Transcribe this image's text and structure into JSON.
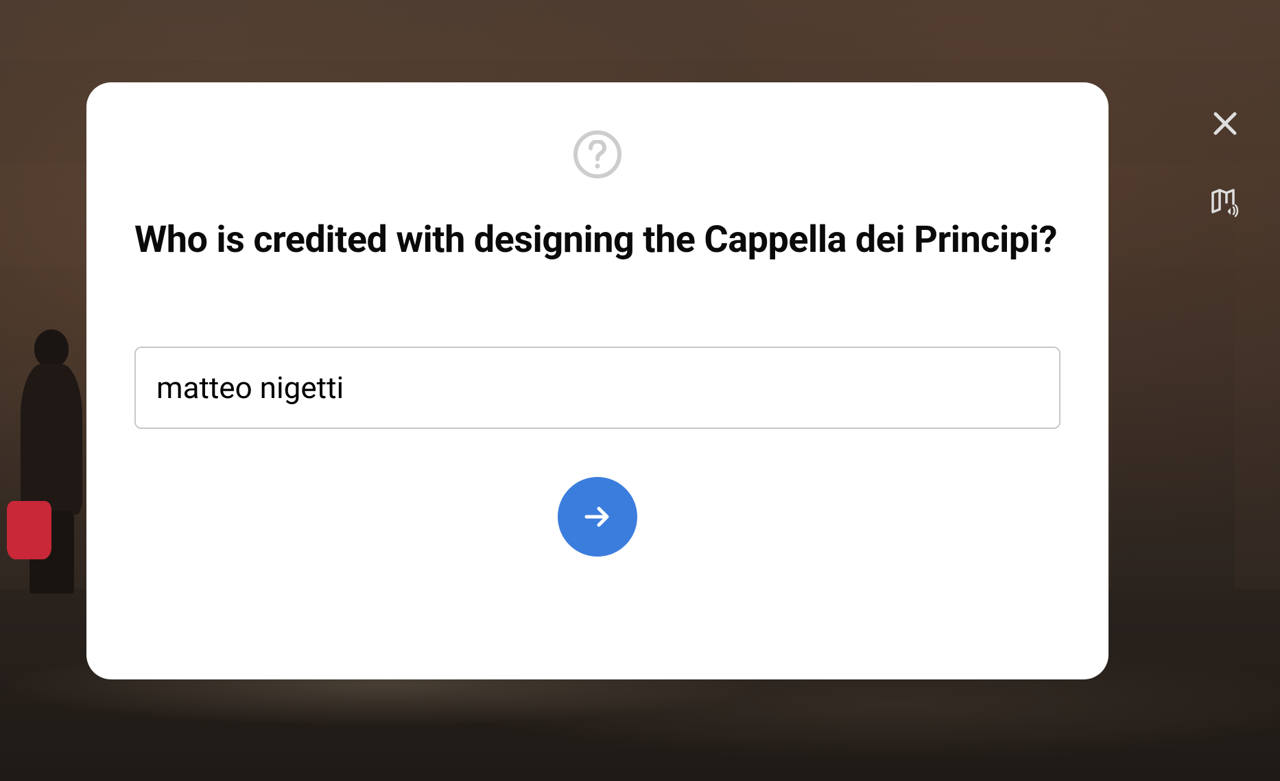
{
  "quiz": {
    "question": "Who is credited with designing the Cappella dei Principi?",
    "answer_value": "matteo nigetti",
    "answer_placeholder": ""
  },
  "colors": {
    "accent": "#3b7ddd",
    "icon_gray": "#cdcdcd",
    "overlay_icon": "#dedede"
  }
}
